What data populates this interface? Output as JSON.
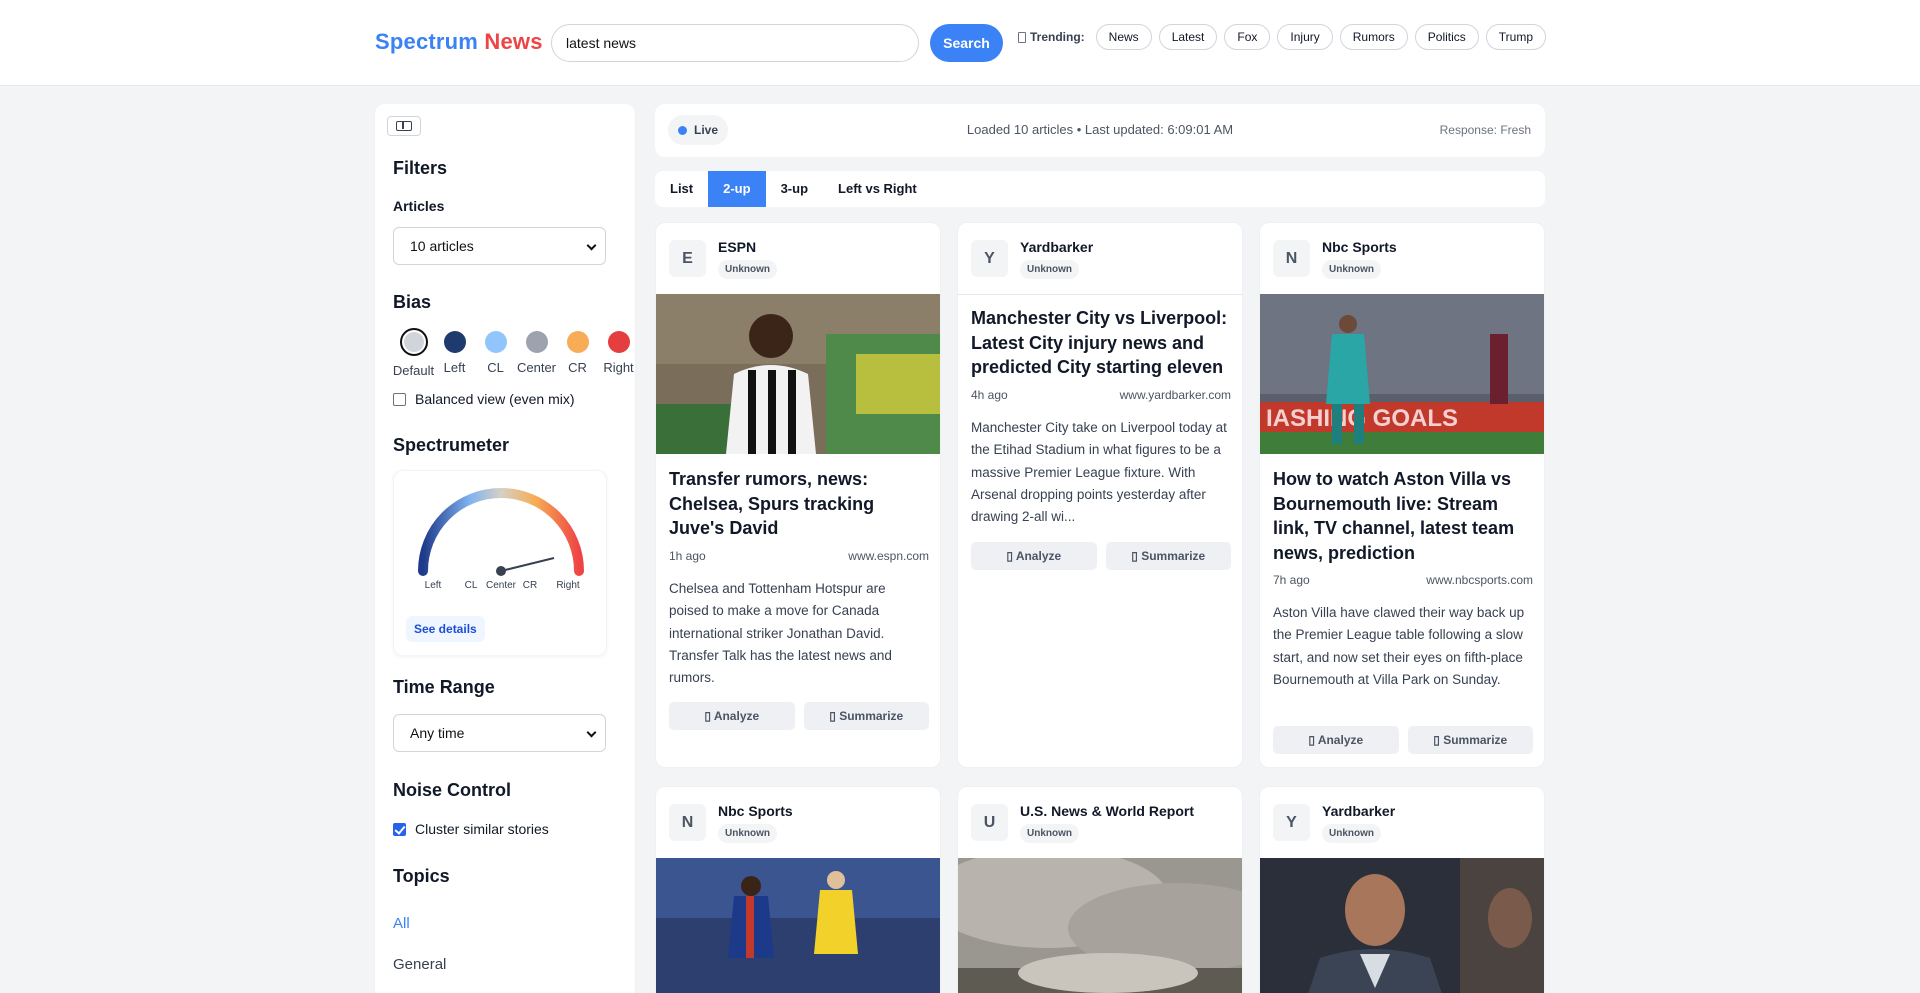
{
  "header": {
    "logo_part1": "Spectrum",
    "logo_part2": "News",
    "search_value": "latest news",
    "search_button": "Search",
    "trending_label": "Trending:",
    "trending": [
      "News",
      "Latest",
      "Fox",
      "Injury",
      "Rumors",
      "Politics",
      "Trump"
    ]
  },
  "sidebar": {
    "filters_title": "Filters",
    "articles_label": "Articles",
    "articles_selected": "10 articles",
    "bias_title": "Bias",
    "bias_options": [
      {
        "label": "Default",
        "color": "#d1d5db"
      },
      {
        "label": "Left",
        "color": "#1e3a6e"
      },
      {
        "label": "CL",
        "color": "#93c5fd"
      },
      {
        "label": "Center",
        "color": "#9ca3af"
      },
      {
        "label": "CR",
        "color": "#f6ad55"
      },
      {
        "label": "Right",
        "color": "#e53e3e"
      }
    ],
    "balanced_label": "Balanced view (even mix)",
    "spectrometer_title": "Spectrumeter",
    "gauge_labels": [
      "Left",
      "CL",
      "Center",
      "CR",
      "Right"
    ],
    "see_details": "See details",
    "time_range_title": "Time Range",
    "time_range_selected": "Any time",
    "noise_title": "Noise Control",
    "cluster_label": "Cluster similar stories",
    "topics_title": "Topics",
    "topics": [
      "All",
      "General"
    ],
    "active_topic_color": "#3b82f6"
  },
  "status": {
    "live_label": "Live",
    "loaded_text": "Loaded 10 articles • Last updated: 6:09:01 AM",
    "response_text": "Response: Fresh"
  },
  "layout_tabs": [
    "List",
    "2-up",
    "3-up",
    "Left vs Right"
  ],
  "active_tab": "2-up",
  "actions": {
    "analyze": "Analyze",
    "summarize": "Summarize"
  },
  "cards": [
    {
      "initial": "E",
      "source": "ESPN",
      "badge": "Unknown",
      "title": "Transfer rumors, news: Chelsea, Spurs tracking Juve's David",
      "time": "1h ago",
      "domain": "www.espn.com",
      "snippet": "Chelsea and Tottenham Hotspur are poised to make a move for Canada international striker Jonathan David. Transfer Talk has the latest news and rumors."
    },
    {
      "initial": "Y",
      "source": "Yardbarker",
      "badge": "Unknown",
      "title": "Manchester City vs Liverpool: Latest City injury news and predicted City starting eleven",
      "time": "4h ago",
      "domain": "www.yardbarker.com",
      "snippet": "Manchester City take on Liverpool today at the Etihad Stadium in what figures to be a massive Premier League fixture. With Arsenal dropping points yesterday after drawing 2-all wi..."
    },
    {
      "initial": "N",
      "source": "Nbc Sports",
      "badge": "Unknown",
      "title": "How to watch Aston Villa vs Bournemouth live: Stream link, TV channel, latest team news, prediction",
      "time": "7h ago",
      "domain": "www.nbcsports.com",
      "snippet": "Aston Villa have clawed their way back up the Premier League table following a slow start, and now set their eyes on fifth-place Bournemouth at Villa Park on Sunday."
    },
    {
      "initial": "N",
      "source": "Nbc Sports",
      "badge": "Unknown"
    },
    {
      "initial": "U",
      "source": "U.S. News & World Report",
      "badge": "Unknown"
    },
    {
      "initial": "Y",
      "source": "Yardbarker",
      "badge": "Unknown"
    }
  ]
}
